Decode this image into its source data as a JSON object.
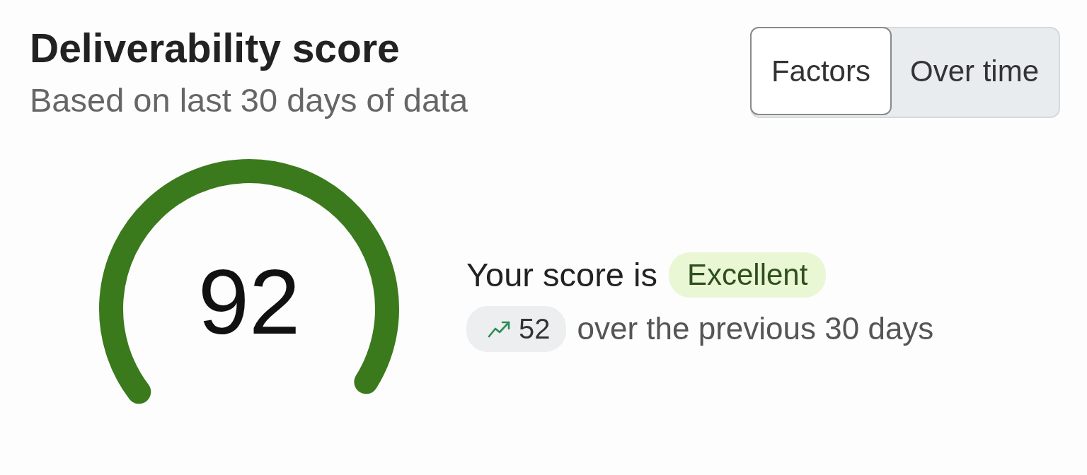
{
  "header": {
    "title": "Deliverability score",
    "subtitle": "Based on last 30 days of data"
  },
  "tabs": [
    {
      "label": "Factors",
      "selected": true
    },
    {
      "label": "Over time",
      "selected": false
    }
  ],
  "gauge": {
    "value": "92"
  },
  "summary": {
    "prefix": "Your score is",
    "rating": "Excellent",
    "change": "52",
    "change_text": "over the previous 30 days"
  }
}
